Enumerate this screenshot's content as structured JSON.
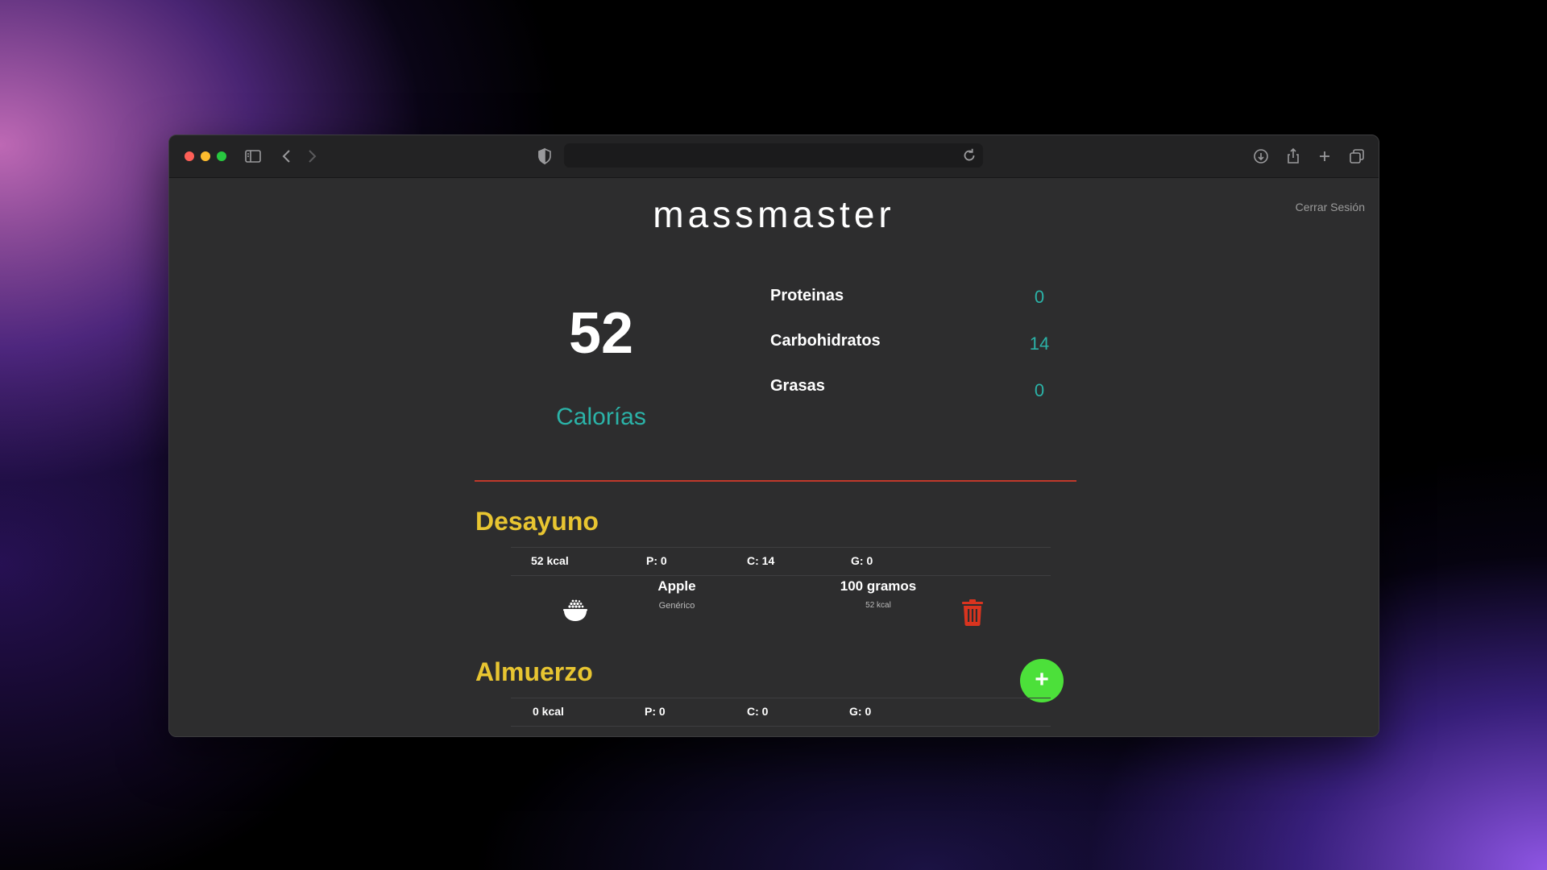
{
  "browser": {
    "url": "",
    "icons": [
      "sidebar-icon",
      "back-icon",
      "forward-icon",
      "shield-icon",
      "reload-icon",
      "download-icon",
      "share-icon",
      "new-tab-icon",
      "tabs-overview-icon"
    ]
  },
  "header": {
    "logo": "massmaster",
    "logout_label": "Cerrar Sesión"
  },
  "summary": {
    "calories": "52",
    "calories_label": "Calorías",
    "macros": [
      {
        "label": "Proteinas",
        "value": "0"
      },
      {
        "label": "Carbohidratos",
        "value": "14"
      },
      {
        "label": "Grasas",
        "value": "0"
      }
    ]
  },
  "meals": [
    {
      "title": "Desayuno",
      "kcal": "52 kcal",
      "protein": "P: 0",
      "carbs": "C: 14",
      "fat": "G: 0",
      "items": [
        {
          "icon": "food-bowl-icon",
          "name": "Apple",
          "brand": "Genérico",
          "quantity": "100 gramos",
          "kcal": "52 kcal"
        }
      ]
    },
    {
      "title": "Almuerzo",
      "kcal": "0 kcal",
      "protein": "P: 0",
      "carbs": "C: 0",
      "fat": "G: 0",
      "items": []
    }
  ],
  "actions": {
    "add_label": "+"
  },
  "colors": {
    "accent_teal": "#2bb3a8",
    "meal_title_yellow": "#e8c531",
    "divider_red": "#c0392b",
    "delete_red": "#d9341f",
    "add_green": "#4ce03a",
    "content_bg": "#2d2d2e"
  }
}
